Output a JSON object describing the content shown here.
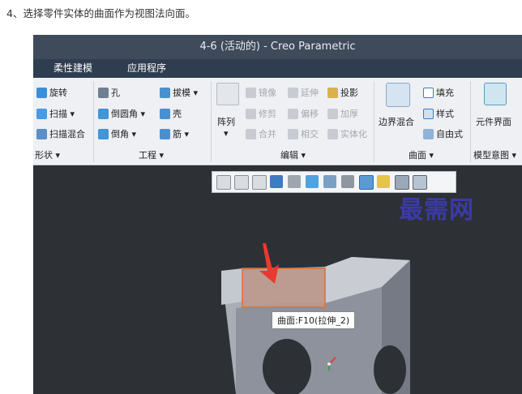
{
  "step_text": "4、选择零件实体的曲面作为视图法向面。",
  "window": {
    "title": "4-6 (活动的) - Creo Parametric"
  },
  "menu": {
    "items": [
      "柔性建模",
      "应用程序"
    ]
  },
  "ribbon": {
    "shape": {
      "items": [
        "旋转",
        "扫描 ▾",
        "扫描混合"
      ],
      "group_label": "形状 ▾"
    },
    "engineering": {
      "items": [
        "孔",
        "倒圆角 ▾",
        "倒角 ▾",
        "拔模 ▾",
        "壳",
        "筋 ▾"
      ],
      "group_label": "工程 ▾"
    },
    "edit": {
      "pattern_label": "阵列",
      "items": [
        "镜像",
        "延伸",
        "投影",
        "修剪",
        "偏移",
        "加厚",
        "合并",
        "相交",
        "实体化"
      ],
      "group_label": "编辑 ▾"
    },
    "surface": {
      "boundary_blend_label": "边界混合",
      "items": [
        "填充",
        "样式",
        "自由式"
      ],
      "group_label": "曲面 ▾"
    },
    "model_intent": {
      "component_interface_label": "元件界面",
      "group_label": "模型意图 ▾"
    }
  },
  "tooltip": {
    "text": "曲面:F10(拉伸_2)"
  },
  "watermark": {
    "text": "最需网"
  },
  "colors": {
    "titlebar": "#3f4a5a",
    "menubar": "#2f3d50",
    "ribbon": "#eef0f3",
    "canvas": "#2d3034",
    "highlight": "#e0702a"
  }
}
